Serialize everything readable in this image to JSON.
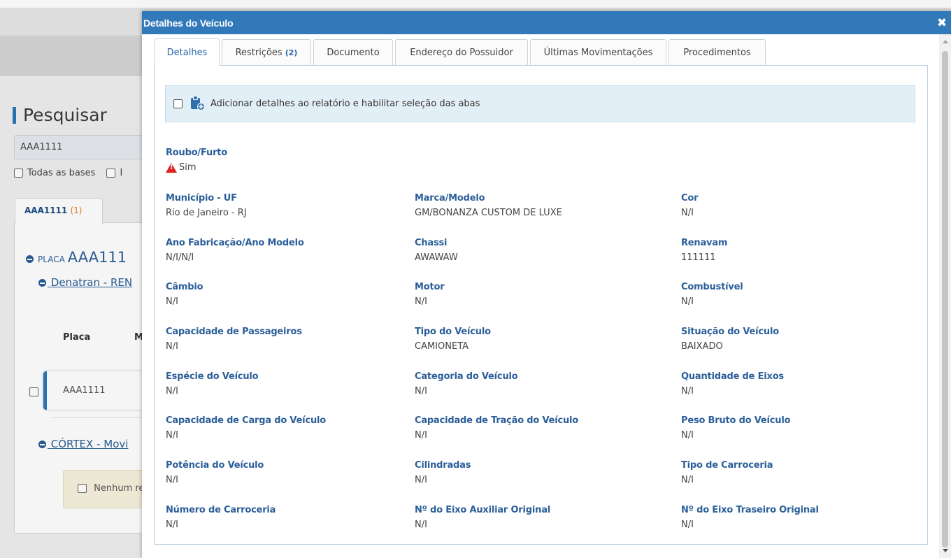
{
  "background": {
    "page_title": "Pesquisar",
    "search_value": "AAA1111",
    "option_all_bases": "Todas as bases",
    "option_second_partial": "I",
    "result_tab_label": "AAA1111",
    "result_tab_count": "(1)",
    "placa_label": "PLACA",
    "placa_value": "AAA111",
    "denatran_link": "Denatran - REN",
    "col_placa": "Placa",
    "col_second": "M",
    "row_placa": "AAA1111",
    "cortex_link": "CÓRTEX - Movi",
    "notice_text": "Nenhum re"
  },
  "modal": {
    "title": "Detalhes do Veículo",
    "close_icon": "close-icon",
    "tabs": [
      {
        "label": "Detalhes",
        "badge": ""
      },
      {
        "label": "Restrições",
        "badge": "(2)"
      },
      {
        "label": "Documento",
        "badge": ""
      },
      {
        "label": "Endereço do Possuidor",
        "badge": ""
      },
      {
        "label": "Últimas Movimentações",
        "badge": ""
      },
      {
        "label": "Procedimentos",
        "badge": ""
      }
    ],
    "info_text": "Adicionar detalhes ao relatório e habilitar seleção das abas",
    "roubo": {
      "label": "Roubo/Furto",
      "value": "Sim"
    },
    "fields": [
      {
        "label": "Município - UF",
        "value": "Rio de Janeiro - RJ"
      },
      {
        "label": "Marca/Modelo",
        "value": "GM/BONANZA CUSTOM DE LUXE"
      },
      {
        "label": "Cor",
        "value": "N/I"
      },
      {
        "label": "Ano Fabricação/Ano Modelo",
        "value": "N/I/N/I"
      },
      {
        "label": "Chassi",
        "value": "AWAWAW"
      },
      {
        "label": "Renavam",
        "value": "111111"
      },
      {
        "label": "Câmbio",
        "value": "N/I"
      },
      {
        "label": "Motor",
        "value": "N/I"
      },
      {
        "label": "Combustível",
        "value": "N/I"
      },
      {
        "label": "Capacidade de Passageiros",
        "value": "N/I"
      },
      {
        "label": "Tipo do Veículo",
        "value": "CAMIONETA"
      },
      {
        "label": "Situação do Veículo",
        "value": "BAIXADO"
      },
      {
        "label": "Espécie do Veículo",
        "value": "N/I"
      },
      {
        "label": "Categoria do Veículo",
        "value": "N/I"
      },
      {
        "label": "Quantidade de Eixos",
        "value": "N/I"
      },
      {
        "label": "Capacidade de Carga do Veículo",
        "value": "N/I"
      },
      {
        "label": "Capacidade de Tração do Veículo",
        "value": "N/I"
      },
      {
        "label": "Peso Bruto do Veículo",
        "value": "N/I"
      },
      {
        "label": "Potência do Veículo",
        "value": "N/I"
      },
      {
        "label": "Cilindradas",
        "value": "N/I"
      },
      {
        "label": "Tipo de Carroceria",
        "value": "N/I"
      },
      {
        "label": "Número de Carroceria",
        "value": "N/I"
      },
      {
        "label": "Nº do Eixo Auxiliar Original",
        "value": "N/I"
      },
      {
        "label": "Nº do Eixo Traseiro Original",
        "value": "N/I"
      }
    ]
  }
}
